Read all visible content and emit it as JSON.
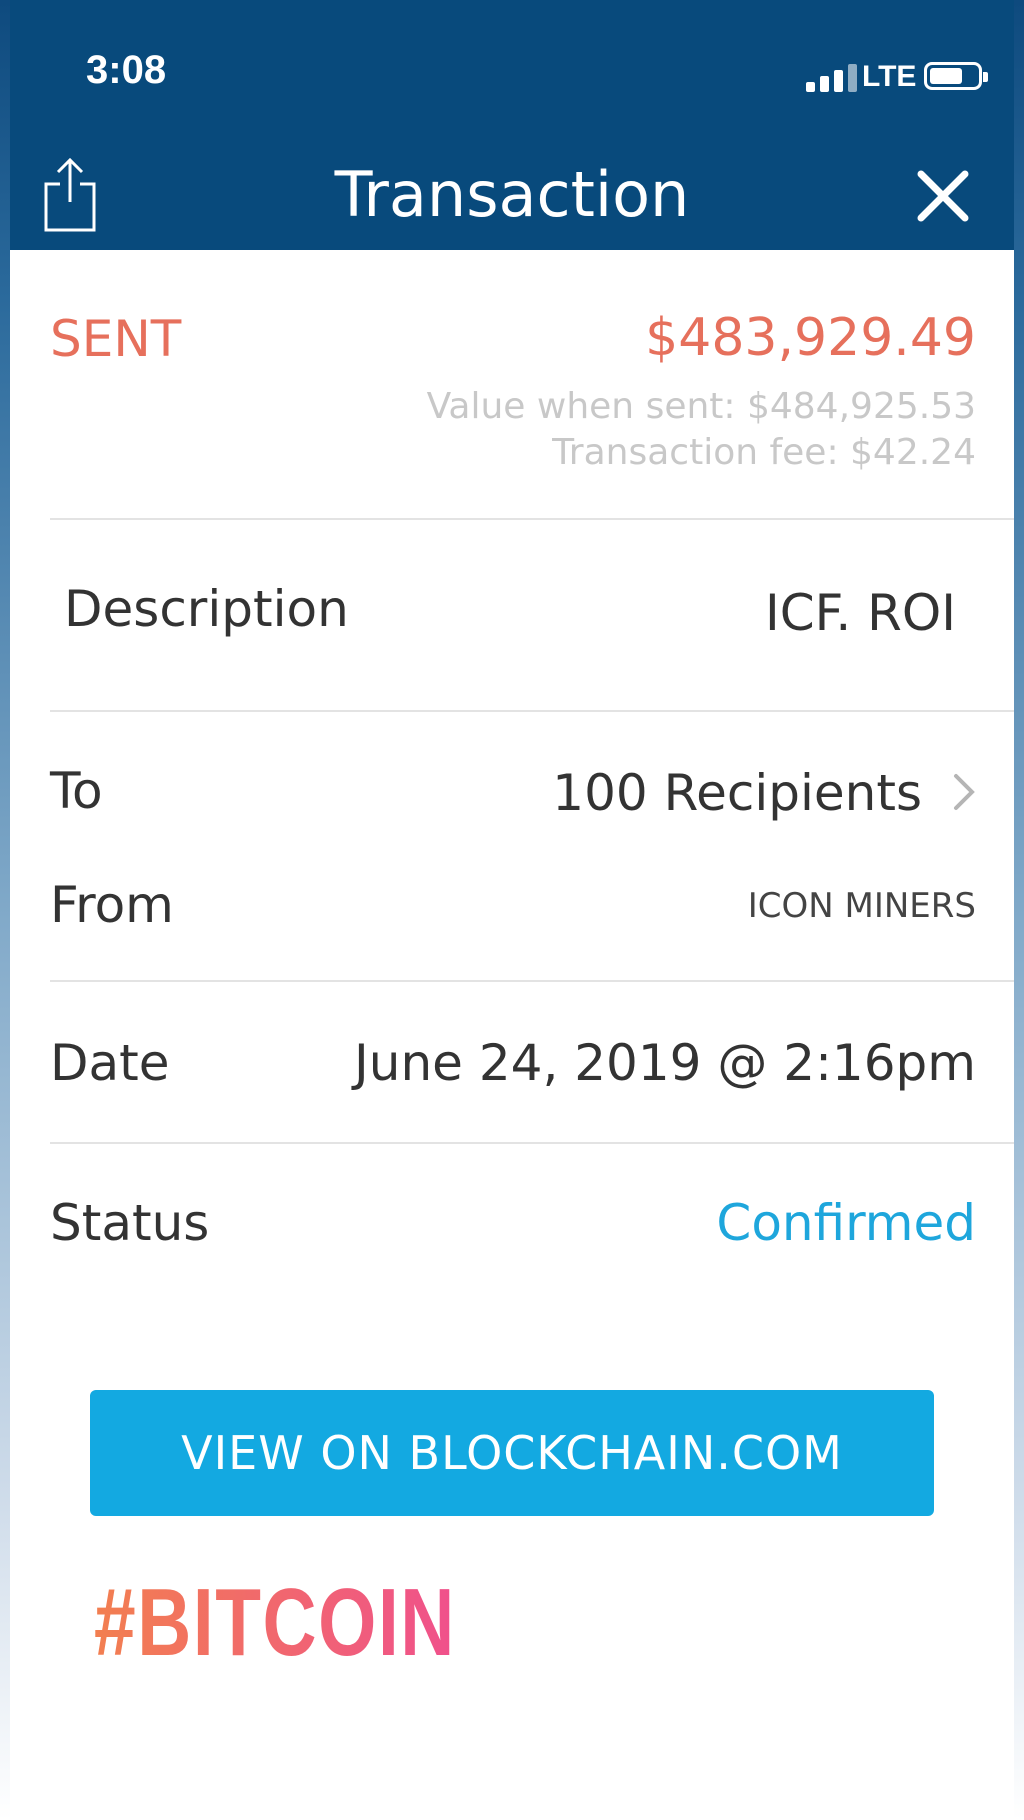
{
  "status_bar": {
    "time": "3:08",
    "network": "LTE"
  },
  "header": {
    "title": "Transaction",
    "share_icon": "share-icon",
    "close_icon": "close-icon",
    "background": "#084a7c"
  },
  "summary": {
    "direction": "SENT",
    "amount": "$483,929.49",
    "value_when_sent": "Value when sent: $484,925.53",
    "transaction_fee": "Transaction fee: $42.24",
    "accent": "#e6705c"
  },
  "details": {
    "description_label": "Description",
    "description_value": "ICF. ROI",
    "to_label": "To",
    "to_value": "100 Recipients",
    "from_label": "From",
    "from_value": "ICON MINERS",
    "date_label": "Date",
    "date_value": "June 24, 2019 @ 2:16pm",
    "status_label": "Status",
    "status_value": "Confirmed",
    "status_color": "#1ea6dc"
  },
  "actions": {
    "view_button": "VIEW ON BLOCKCHAIN.COM",
    "button_color": "#13a9e1"
  },
  "overlay": {
    "hashtag": "#BITCOIN"
  }
}
